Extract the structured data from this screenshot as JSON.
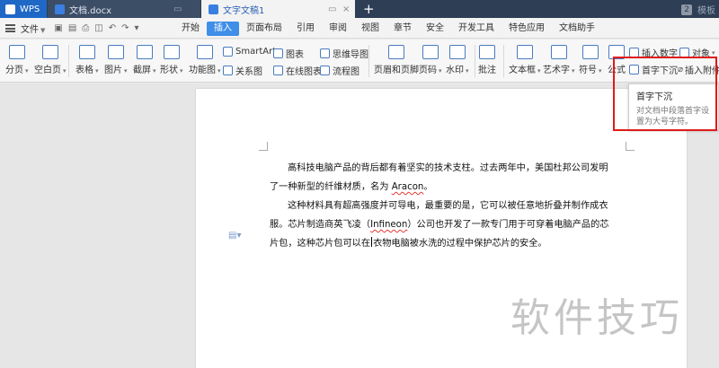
{
  "titlebar": {
    "wps_label": "WPS",
    "tabs": [
      {
        "label": "文档.docx"
      },
      {
        "label": "文字文稿1"
      }
    ],
    "new_tab": "+",
    "badge": "2",
    "skin_label": "模板"
  },
  "menubar": {
    "file_label": "文件",
    "tabs": [
      "开始",
      "插入",
      "页面布局",
      "引用",
      "审阅",
      "视图",
      "章节",
      "安全",
      "开发工具",
      "特色应用",
      "文档助手"
    ],
    "active_tab": "插入"
  },
  "ribbon": {
    "page_break": "分页",
    "blank_page": "空白页",
    "table": "表格",
    "picture": "图片",
    "screenshot": "截屏",
    "shapes": "形状",
    "function_chart": "功能图",
    "smartart": "SmartArt",
    "relation_chart": "关系图",
    "chart": "图表",
    "online_chart": "在线图表",
    "mind_map": "思维导图",
    "flowchart": "流程图",
    "header_footer": "页眉和页脚",
    "page_number": "页码",
    "watermark": "水印",
    "comment": "批注",
    "textbox": "文本框",
    "wordart": "艺术字",
    "symbol": "符号",
    "formula": "公式",
    "insert_number": "插入数字",
    "object": "对象",
    "drop_cap": "首字下沉",
    "attachment": "插入附件"
  },
  "tooltip": {
    "title": "首字下沉",
    "description": "对文档中段落首字设置为大号字符。"
  },
  "document": {
    "p1_a": "高科技电脑产品的背后都有着坚实的技术支柱。过去两年中，美国杜邦公司发明了一种新型的纤维材质，名为 ",
    "p1_word": "Aracon",
    "p1_b": "。",
    "p2_a": "这种材料具有超高强度并可导电，最重要的是，它可以被任意地折叠并制作成衣服。芯片制造商英飞凌（",
    "p2_word": "Infineon",
    "p2_b": "）公司也开发了一款专门用于可穿着电脑产品的芯片包，这种芯片包可以在",
    "p2_c": "衣物电脑被水洗的过程中保护芯片的安全。"
  },
  "watermark_text": "软件技巧",
  "colors": {
    "titlebar_bg": "#2d3e55",
    "active_tab": "#3f8ee8",
    "highlight_box": "#e11a1a"
  }
}
